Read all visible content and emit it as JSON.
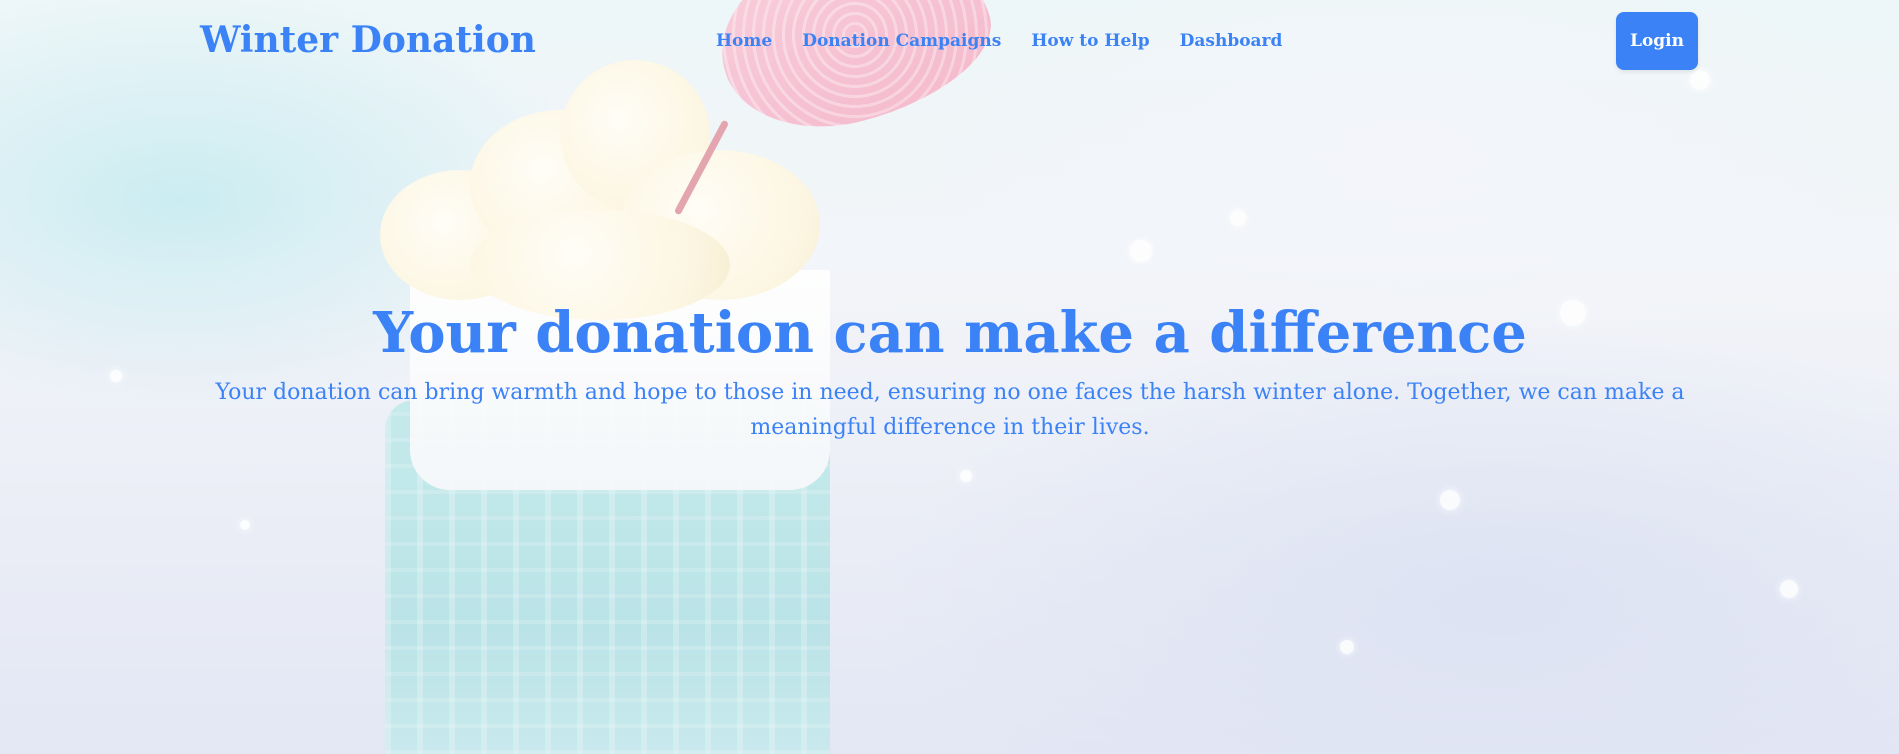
{
  "brand": "Winter Donation",
  "nav": {
    "links": [
      "Home",
      "Donation Campaigns",
      "How to Help",
      "Dashboard"
    ],
    "login_label": "Login"
  },
  "hero": {
    "title": "Your donation can make a difference",
    "subtitle": "Your donation can bring warmth and hope to those in need, ensuring no one faces the harsh winter alone. Together, we can make a meaningful difference in their lives."
  },
  "colors": {
    "accent": "#3b82f6",
    "button_text": "#ffffff"
  },
  "background_image": "winter-hot-drink-photo"
}
